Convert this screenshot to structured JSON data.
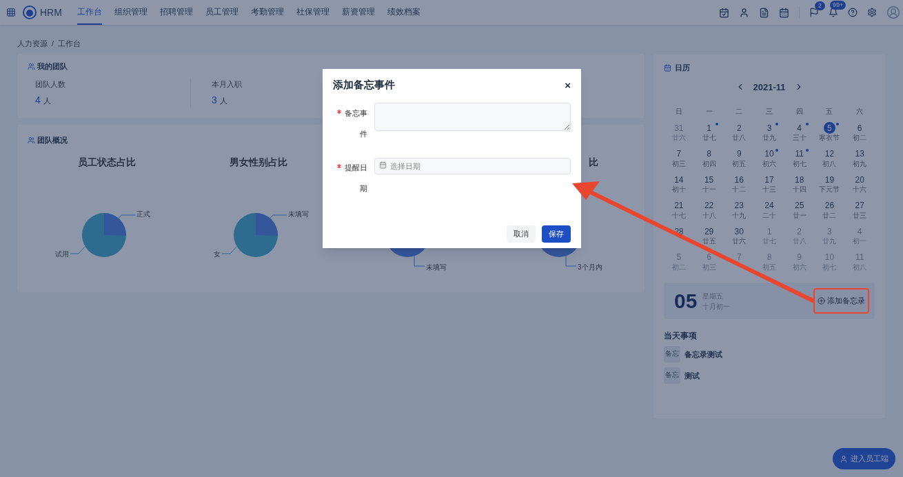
{
  "topbar": {
    "brand": "HRM",
    "nav": [
      {
        "label": "工作台",
        "selected": true
      },
      {
        "label": "组织管理",
        "selected": false
      },
      {
        "label": "招聘管理",
        "selected": false
      },
      {
        "label": "员工管理",
        "selected": false
      },
      {
        "label": "考勤管理",
        "selected": false
      },
      {
        "label": "社保管理",
        "selected": false
      },
      {
        "label": "薪资管理",
        "selected": false
      },
      {
        "label": "绩效档案",
        "selected": false
      }
    ],
    "flag_badge": "2",
    "bell_badge": "99+"
  },
  "breadcrumb": {
    "items": [
      "人力资源",
      "工作台"
    ],
    "separator": "/"
  },
  "my_team": {
    "title": "我的团队",
    "stats": [
      {
        "label": "团队人数",
        "value": "4",
        "unit": "人"
      },
      {
        "label": "本月入职",
        "value": "3",
        "unit": "人"
      }
    ]
  },
  "team_overview": {
    "title": "团队概况",
    "charts": [
      {
        "kind": "two-slice",
        "title": "员工状态占比",
        "labels": [
          "正式",
          "试用"
        ]
      },
      {
        "kind": "two-slice",
        "title": "男女性别占比",
        "labels": [
          "未填写",
          "女"
        ]
      },
      {
        "kind": "single",
        "labels": [
          "未填写"
        ]
      },
      {
        "kind": "single",
        "title": "比",
        "labels": [
          "3个月内"
        ]
      }
    ]
  },
  "calendar": {
    "title": "日历",
    "month": "2021-11",
    "weekdays": [
      "日",
      "一",
      "二",
      "三",
      "四",
      "五",
      "六"
    ],
    "weeks": [
      [
        {
          "day": "31",
          "lunar": "廿六",
          "in_month": false,
          "dot": false,
          "selected": false
        },
        {
          "day": "1",
          "lunar": "廿七",
          "in_month": true,
          "dot": true,
          "selected": false
        },
        {
          "day": "2",
          "lunar": "廿八",
          "in_month": true,
          "dot": false,
          "selected": false
        },
        {
          "day": "3",
          "lunar": "廿九",
          "in_month": true,
          "dot": true,
          "selected": false
        },
        {
          "day": "4",
          "lunar": "三十",
          "in_month": true,
          "dot": true,
          "selected": false
        },
        {
          "day": "5",
          "lunar": "寒衣节",
          "in_month": true,
          "dot": true,
          "selected": true
        },
        {
          "day": "6",
          "lunar": "初二",
          "in_month": true,
          "dot": false,
          "selected": false
        }
      ],
      [
        {
          "day": "7",
          "lunar": "初三",
          "in_month": true,
          "dot": false,
          "selected": false
        },
        {
          "day": "8",
          "lunar": "初四",
          "in_month": true,
          "dot": false,
          "selected": false
        },
        {
          "day": "9",
          "lunar": "初五",
          "in_month": true,
          "dot": false,
          "selected": false
        },
        {
          "day": "10",
          "lunar": "初六",
          "in_month": true,
          "dot": true,
          "selected": false
        },
        {
          "day": "11",
          "lunar": "初七",
          "in_month": true,
          "dot": true,
          "selected": false
        },
        {
          "day": "12",
          "lunar": "初八",
          "in_month": true,
          "dot": false,
          "selected": false
        },
        {
          "day": "13",
          "lunar": "初九",
          "in_month": true,
          "dot": false,
          "selected": false
        }
      ],
      [
        {
          "day": "14",
          "lunar": "初十",
          "in_month": true,
          "dot": false,
          "selected": false
        },
        {
          "day": "15",
          "lunar": "十一",
          "in_month": true,
          "dot": false,
          "selected": false
        },
        {
          "day": "16",
          "lunar": "十二",
          "in_month": true,
          "dot": false,
          "selected": false
        },
        {
          "day": "17",
          "lunar": "十三",
          "in_month": true,
          "dot": false,
          "selected": false
        },
        {
          "day": "18",
          "lunar": "十四",
          "in_month": true,
          "dot": false,
          "selected": false
        },
        {
          "day": "19",
          "lunar": "下元节",
          "in_month": true,
          "dot": false,
          "selected": false
        },
        {
          "day": "20",
          "lunar": "十六",
          "in_month": true,
          "dot": false,
          "selected": false
        }
      ],
      [
        {
          "day": "21",
          "lunar": "十七",
          "in_month": true,
          "dot": false,
          "selected": false
        },
        {
          "day": "22",
          "lunar": "十八",
          "in_month": true,
          "dot": false,
          "selected": false
        },
        {
          "day": "23",
          "lunar": "十九",
          "in_month": true,
          "dot": false,
          "selected": false
        },
        {
          "day": "24",
          "lunar": "二十",
          "in_month": true,
          "dot": false,
          "selected": false
        },
        {
          "day": "25",
          "lunar": "廿一",
          "in_month": true,
          "dot": false,
          "selected": false
        },
        {
          "day": "26",
          "lunar": "廿二",
          "in_month": true,
          "dot": false,
          "selected": false
        },
        {
          "day": "27",
          "lunar": "廿三",
          "in_month": true,
          "dot": false,
          "selected": false
        }
      ],
      [
        {
          "day": "28",
          "in_month": true,
          "dot": false,
          "selected": false
        },
        {
          "day": "29",
          "lunar": "廿五",
          "in_month": true,
          "dot": false,
          "selected": false
        },
        {
          "day": "30",
          "lunar": "廿六",
          "in_month": true,
          "dot": false,
          "selected": false
        },
        {
          "day": "1",
          "lunar": "廿七",
          "in_month": false,
          "dot": false,
          "selected": false
        },
        {
          "day": "2",
          "lunar": "廿八",
          "in_month": false,
          "dot": false,
          "selected": false
        },
        {
          "day": "3",
          "lunar": "廿九",
          "in_month": false,
          "dot": false,
          "selected": false
        },
        {
          "day": "4",
          "lunar": "初一",
          "in_month": false,
          "dot": false,
          "selected": false
        }
      ],
      [
        {
          "day": "5",
          "lunar": "初二",
          "in_month": false,
          "dot": false,
          "selected": false
        },
        {
          "day": "6",
          "lunar": "初三",
          "in_month": false,
          "dot": false,
          "selected": false
        },
        {
          "day": "7",
          "in_month": false,
          "dot": false,
          "selected": false
        },
        {
          "day": "8",
          "lunar": "初五",
          "in_month": false,
          "dot": false,
          "selected": false
        },
        {
          "day": "9",
          "lunar": "初六",
          "in_month": false,
          "dot": false,
          "selected": false
        },
        {
          "day": "10",
          "lunar": "初七",
          "in_month": false,
          "dot": false,
          "selected": false
        },
        {
          "day": "11",
          "lunar": "初八",
          "in_month": false,
          "dot": false,
          "selected": false
        }
      ]
    ],
    "today": {
      "day": "05",
      "weekday": "星期五",
      "lunar": "十月初一",
      "add_button": "添加备忘录"
    },
    "events_title": "当天事项",
    "events": [
      {
        "tag": "备忘",
        "text": "备忘录测试"
      },
      {
        "tag": "备忘",
        "text": "测试"
      }
    ]
  },
  "employee_button": "进入员工端",
  "modal": {
    "title": "添加备忘事件",
    "close": "×",
    "fields": [
      {
        "kind": "textarea",
        "label": "备忘事件",
        "required": true
      },
      {
        "kind": "date",
        "label": "提醒日期",
        "required": true,
        "placeholder": "选择日期"
      }
    ],
    "buttons": [
      {
        "label": "取消",
        "primary": false
      },
      {
        "label": "保存",
        "primary": true
      }
    ]
  }
}
